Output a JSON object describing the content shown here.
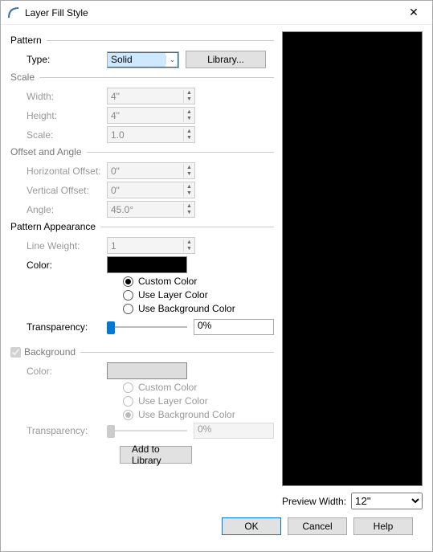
{
  "title": "Layer Fill Style",
  "pattern": {
    "group": "Pattern",
    "type_label": "Type:",
    "type_value": "Solid",
    "library_btn": "Library..."
  },
  "scale": {
    "group": "Scale",
    "width_label": "Width:",
    "width_value": "4\"",
    "height_label": "Height:",
    "height_value": "4\"",
    "scale_label": "Scale:",
    "scale_value": "1.0"
  },
  "offset": {
    "group": "Offset and Angle",
    "hoff_label": "Horizontal Offset:",
    "hoff_value": "0\"",
    "voff_label": "Vertical Offset:",
    "voff_value": "0\"",
    "angle_label": "Angle:",
    "angle_value": "45.0°"
  },
  "appearance": {
    "group": "Pattern Appearance",
    "lw_label": "Line Weight:",
    "lw_value": "1",
    "color_label": "Color:",
    "radio_custom": "Custom Color",
    "radio_layer": "Use Layer Color",
    "radio_bg": "Use Background Color",
    "transp_label": "Transparency:",
    "transp_value": "0%"
  },
  "background": {
    "group": "Background",
    "color_label": "Color:",
    "radio_custom": "Custom Color",
    "radio_layer": "Use Layer Color",
    "radio_bg": "Use Background Color",
    "transp_label": "Transparency:",
    "transp_value": "0%",
    "add_lib": "Add to Library"
  },
  "preview": {
    "pw_label": "Preview Width:",
    "pw_value": "12\""
  },
  "footer": {
    "ok": "OK",
    "cancel": "Cancel",
    "help": "Help"
  }
}
